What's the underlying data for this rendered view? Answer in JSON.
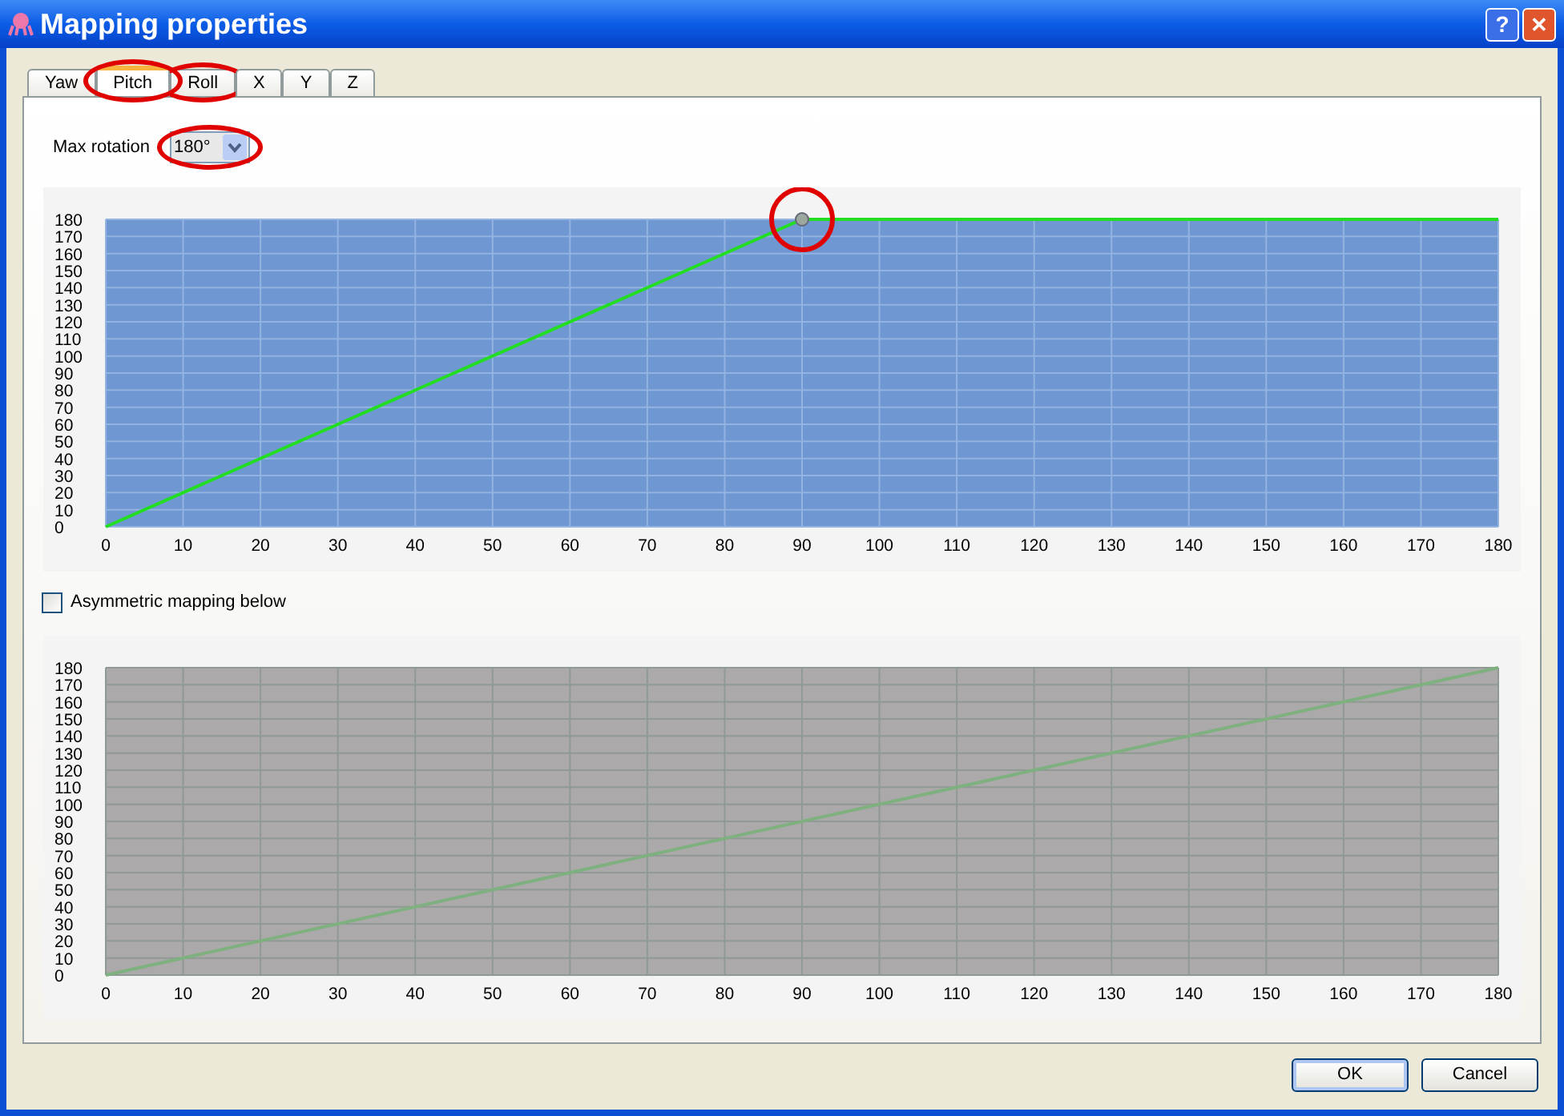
{
  "window": {
    "title": "Mapping properties",
    "help_button": "?",
    "close_button": "✕"
  },
  "tabs": [
    {
      "label": "Yaw",
      "selected": false,
      "circled": false
    },
    {
      "label": "Pitch",
      "selected": true,
      "circled": true
    },
    {
      "label": "Roll",
      "selected": false,
      "circled": true
    },
    {
      "label": "X",
      "selected": false,
      "circled": false
    },
    {
      "label": "Y",
      "selected": false,
      "circled": false
    },
    {
      "label": "Z",
      "selected": false,
      "circled": false
    }
  ],
  "max_rotation": {
    "label": "Max rotation",
    "value": "180°",
    "circled": true
  },
  "upper_chart": {
    "disabled": false,
    "point_circled": true,
    "chart_data": {
      "type": "line",
      "grid": true,
      "x": [
        0,
        90,
        180
      ],
      "series": [
        {
          "color": "#22dd22",
          "values": [
            0,
            180,
            180
          ]
        }
      ],
      "xlim": [
        0,
        180
      ],
      "ylim": [
        0,
        180
      ],
      "xticks": [
        0,
        10,
        20,
        30,
        40,
        50,
        60,
        70,
        80,
        90,
        100,
        110,
        120,
        130,
        140,
        150,
        160,
        170,
        180
      ],
      "yticks": [
        0,
        10,
        20,
        30,
        40,
        50,
        60,
        70,
        80,
        90,
        100,
        110,
        120,
        130,
        140,
        150,
        160,
        170,
        180
      ]
    }
  },
  "asymmetric": {
    "label": "Asymmetric mapping below",
    "checked": false
  },
  "lower_chart": {
    "disabled": true,
    "chart_data": {
      "type": "line",
      "grid": true,
      "x": [
        0,
        180
      ],
      "series": [
        {
          "color": "#7fb07f",
          "values": [
            0,
            180
          ]
        }
      ],
      "xlim": [
        0,
        180
      ],
      "ylim": [
        0,
        180
      ],
      "xticks": [
        0,
        10,
        20,
        30,
        40,
        50,
        60,
        70,
        80,
        90,
        100,
        110,
        120,
        130,
        140,
        150,
        160,
        170,
        180
      ],
      "yticks": [
        0,
        10,
        20,
        30,
        40,
        50,
        60,
        70,
        80,
        90,
        100,
        110,
        120,
        130,
        140,
        150,
        160,
        170,
        180
      ]
    }
  },
  "buttons": [
    {
      "label": "OK",
      "kind": "default"
    },
    {
      "label": "Cancel",
      "kind": "normal"
    }
  ]
}
